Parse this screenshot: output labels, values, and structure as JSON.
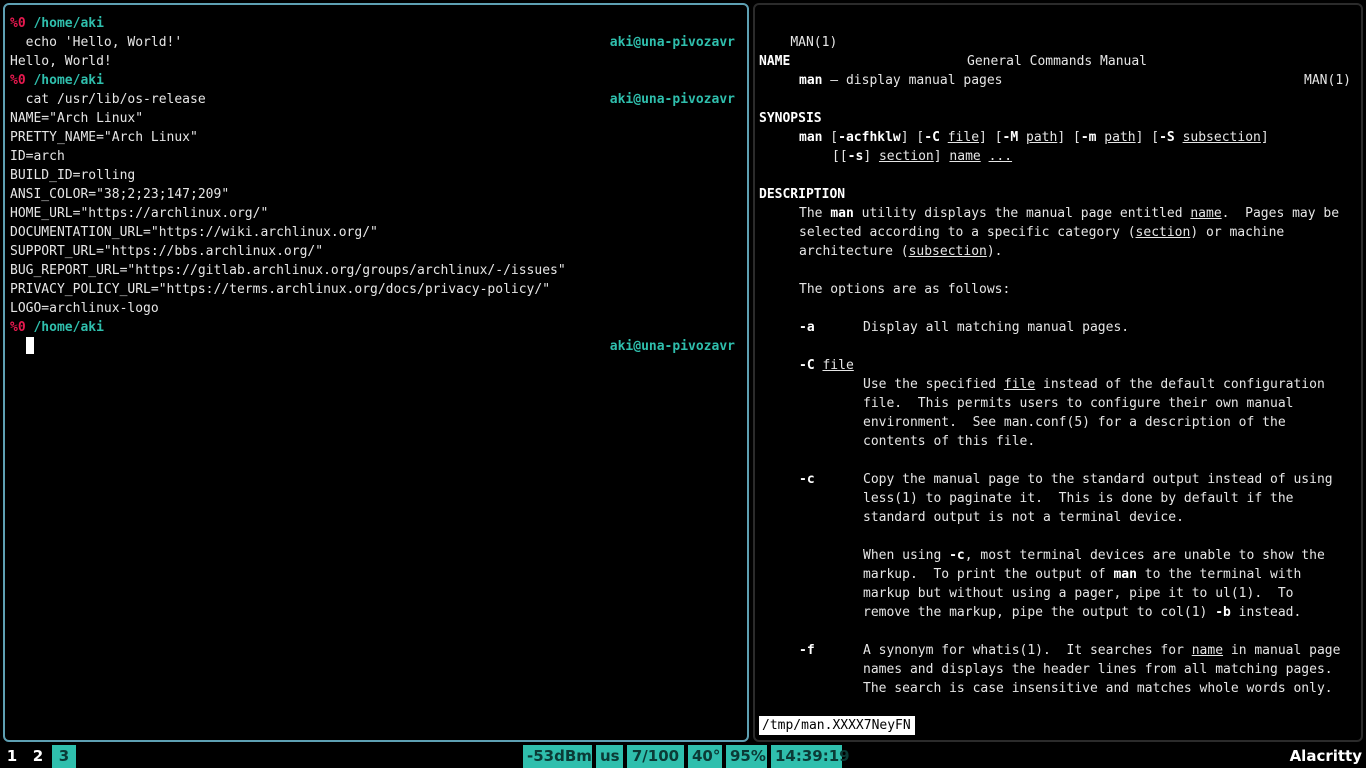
{
  "left_terminal": {
    "prompt1": {
      "num": "%0",
      "dir": "/home/aki",
      "host": "aki@una-pivozavr"
    },
    "cmd1": "  echo 'Hello, World!'",
    "out1": "Hello, World!",
    "prompt2": {
      "num": "%0",
      "dir": "/home/aki",
      "host": "aki@una-pivozavr"
    },
    "cmd2": "  cat /usr/lib/os-release",
    "os_release": [
      "NAME=\"Arch Linux\"",
      "PRETTY_NAME=\"Arch Linux\"",
      "ID=arch",
      "BUILD_ID=rolling",
      "ANSI_COLOR=\"38;2;23;147;209\"",
      "HOME_URL=\"https://archlinux.org/\"",
      "DOCUMENTATION_URL=\"https://wiki.archlinux.org/\"",
      "SUPPORT_URL=\"https://bbs.archlinux.org/\"",
      "BUG_REPORT_URL=\"https://gitlab.archlinux.org/groups/archlinux/-/issues\"",
      "PRIVACY_POLICY_URL=\"https://terms.archlinux.org/docs/privacy-policy/\"",
      "LOGO=archlinux-logo"
    ],
    "prompt3": {
      "num": "%0",
      "dir": "/home/aki",
      "host": "aki@una-pivozavr"
    }
  },
  "man": {
    "header_left": "MAN(1)",
    "header_center": "General Commands Manual",
    "header_right": "MAN(1)",
    "name_heading": "NAME",
    "name_cmd": "man",
    "name_desc": " – display manual pages",
    "synopsis_heading": "SYNOPSIS",
    "syn": {
      "man": "man",
      "open1": " [",
      "flags": "-acfhklw",
      "c1": "] [",
      "C": "-C",
      "file": "file",
      "c2": "] [",
      "M": "-M",
      "path1": "path",
      "c3": "] [",
      "m": "-m",
      "path2": "path",
      "c4": "] [",
      "S": "-S",
      "subsection": "subsection",
      "c5": "]",
      "l2_open": "[[",
      "s": "-s",
      "l2_mid": "] ",
      "section": "section",
      "l2_close": "] ",
      "name": "name",
      "dots": "..."
    },
    "description_heading": "DESCRIPTION",
    "desc1": {
      "a": "The ",
      "man": "man",
      "b": " utility displays the manual page entitled ",
      "name": "name",
      "c": ".  Pages may be"
    },
    "desc2": {
      "a": "selected according to a specific category (",
      "section": "section",
      "b": ") or machine"
    },
    "desc3": {
      "a": "architecture (",
      "subsection": "subsection",
      "b": ")."
    },
    "options_intro": "The options are as follows:",
    "opt_a": {
      "flag": "-a",
      "text": "Display all matching manual pages."
    },
    "opt_C": {
      "flag": "-C",
      "arg": "file",
      "l1a": "Use the specified ",
      "l1file": "file",
      "l1b": " instead of the default configuration",
      "l2": "file.  This permits users to configure their own manual",
      "l3": "environment.  See man.conf(5) for a description of the",
      "l4": "contents of this file."
    },
    "opt_c": {
      "flag": "-c",
      "l1": "Copy the manual page to the standard output instead of using",
      "l2": "less(1) to paginate it.  This is done by default if the",
      "l3": "standard output is not a terminal device.",
      "p2l1a": "When using ",
      "p2l1flag": "-c",
      "p2l1b": ", most terminal devices are unable to show the",
      "p2l2a": "markup.  To print the output of ",
      "p2l2man": "man",
      "p2l2b": " to the terminal with",
      "p2l3": "markup but without using a pager, pipe it to ul(1).  To",
      "p2l4a": "remove the markup, pipe the output to col(1) ",
      "p2l4flag": "-b",
      "p2l4b": " instead."
    },
    "opt_f": {
      "flag": "-f",
      "l1a": "A synonym for whatis(1).  It searches for ",
      "l1name": "name",
      "l1b": " in manual page",
      "l2": "names and displays the header lines from all matching pages.",
      "l3": "The search is case insensitive and matches whole words only."
    },
    "pager_status": "/tmp/man.XXXX7NeyFN"
  },
  "statusbar": {
    "workspaces": [
      "1",
      "2",
      "3"
    ],
    "active_workspace": "3",
    "wifi": "-53dBm",
    "layout": "us",
    "volume": "7/100",
    "temp": "40°",
    "battery": "95%",
    "clock": "14:39:19",
    "window_title": "Alacritty"
  },
  "colors": {
    "accent": "#2fbfad",
    "prompt_num": "#e8194f",
    "focused_border": "#5ea0b3"
  }
}
